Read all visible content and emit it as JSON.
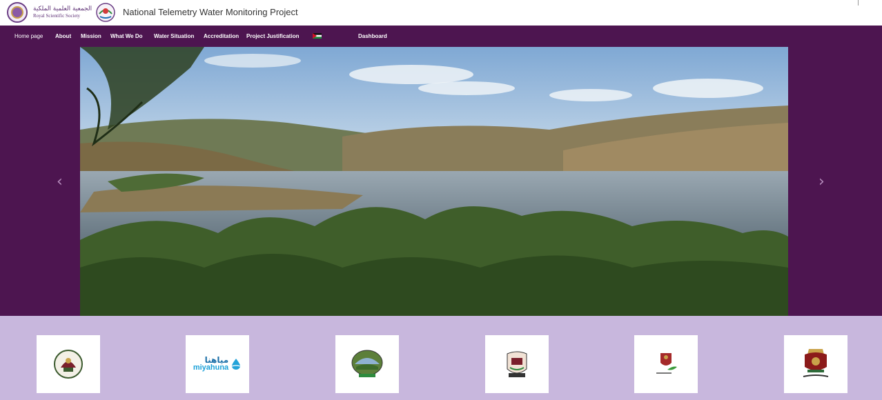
{
  "header": {
    "rss_logo": {
      "arabic": "الجمعية العلمية الملكية",
      "english": "Royal Scientific Society"
    },
    "project_title": "National Telemetry Water Monitoring Project"
  },
  "nav": {
    "items": [
      {
        "label": "Home page"
      },
      {
        "label": "About"
      },
      {
        "label": "Mission"
      },
      {
        "label": "What We Do"
      },
      {
        "label": "Water Situation"
      },
      {
        "label": "Accreditation"
      },
      {
        "label": "Project Justification"
      },
      {
        "label": "Dashboard"
      }
    ],
    "language_icon": "jordan-flag-icon"
  },
  "carousel": {
    "prev_icon": "chevron-left-icon",
    "next_icon": "chevron-right-icon",
    "prev_glyph": "‹",
    "next_glyph": "›"
  },
  "partners": {
    "miyahuna": {
      "arabic": "مياهنا",
      "english": "miyahuna"
    }
  },
  "colors": {
    "brand_purple": "#4d1550",
    "partner_band": "#c8b7dd"
  }
}
